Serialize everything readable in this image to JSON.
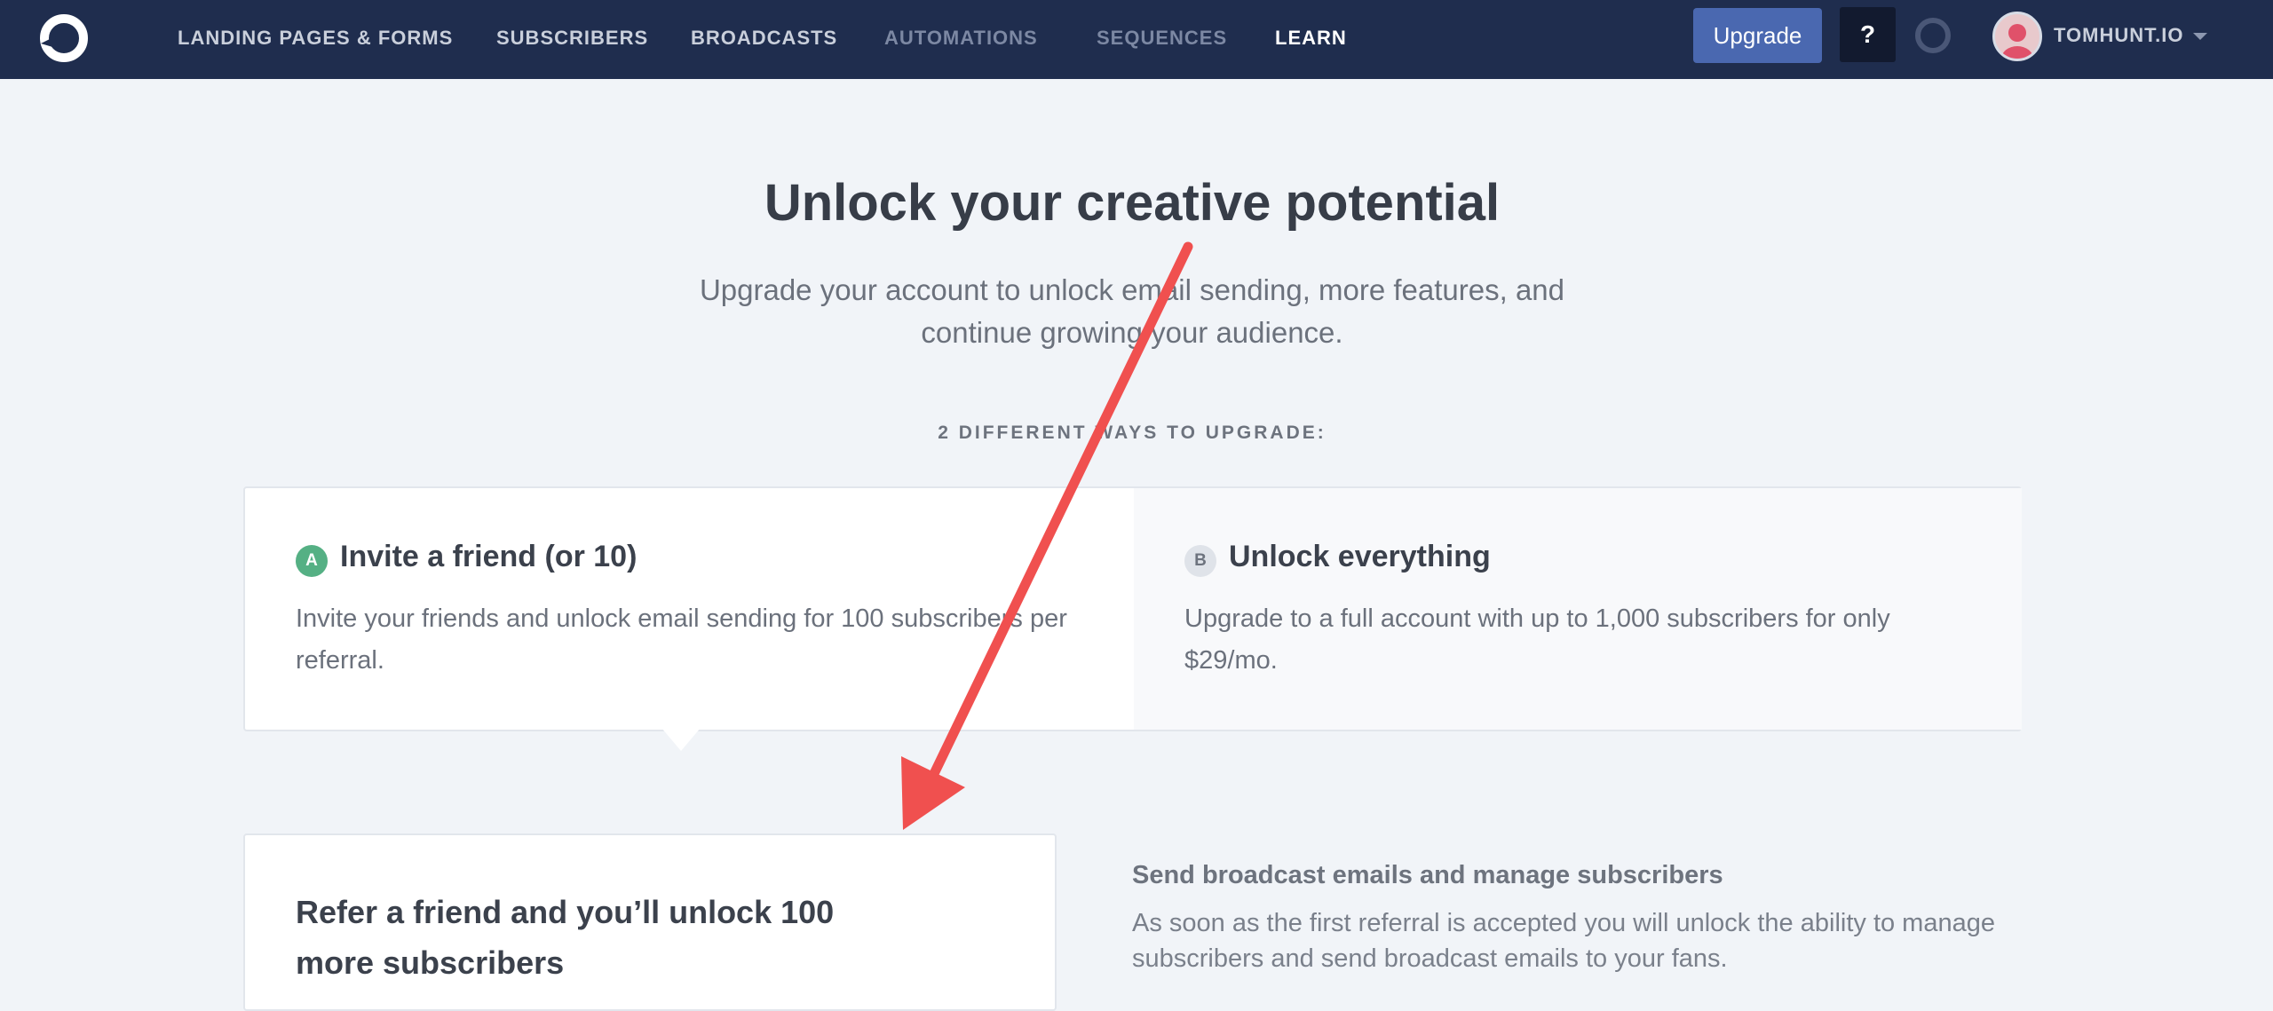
{
  "nav": {
    "logo_icon": "convertkit-logo-icon",
    "items": [
      {
        "label": "LANDING PAGES & FORMS",
        "state": "active"
      },
      {
        "label": "SUBSCRIBERS",
        "state": "active"
      },
      {
        "label": "BROADCASTS",
        "state": "active"
      },
      {
        "label": "AUTOMATIONS",
        "state": "disabled"
      },
      {
        "label": "SEQUENCES",
        "state": "disabled"
      },
      {
        "label": "LEARN",
        "state": "active"
      }
    ],
    "upgrade_label": "Upgrade",
    "help_label": "?",
    "account_name": "TOMHUNT.IO"
  },
  "hero": {
    "title": "Unlock your creative potential",
    "subtitle": "Upgrade your account to unlock email sending, more features, and continue growing your audience.",
    "ways_label": "2 DIFFERENT WAYS TO UPGRADE:"
  },
  "options": [
    {
      "badge": "A",
      "title": "Invite a friend (or 10)",
      "description": "Invite your friends and unlock email sending for 100 subscribers per referral."
    },
    {
      "badge": "B",
      "title": "Unlock everything",
      "description": "Upgrade to a full account with up to 1,000 subscribers for only $29/mo."
    }
  ],
  "referral": {
    "title": "Refer a friend and you’ll unlock 100 more subscribers",
    "benefit_title": "Send broadcast emails and manage subscribers",
    "benefit_description": "As soon as the first referral is accepted you will unlock the ability to manage subscribers and send broadcast emails to your fans."
  },
  "colors": {
    "nav_bg": "#1f2d4e",
    "upgrade_button": "#4a68b0",
    "badge_a": "#55b084",
    "annotation_arrow": "#f0504f",
    "page_bg": "#f1f4f8"
  }
}
